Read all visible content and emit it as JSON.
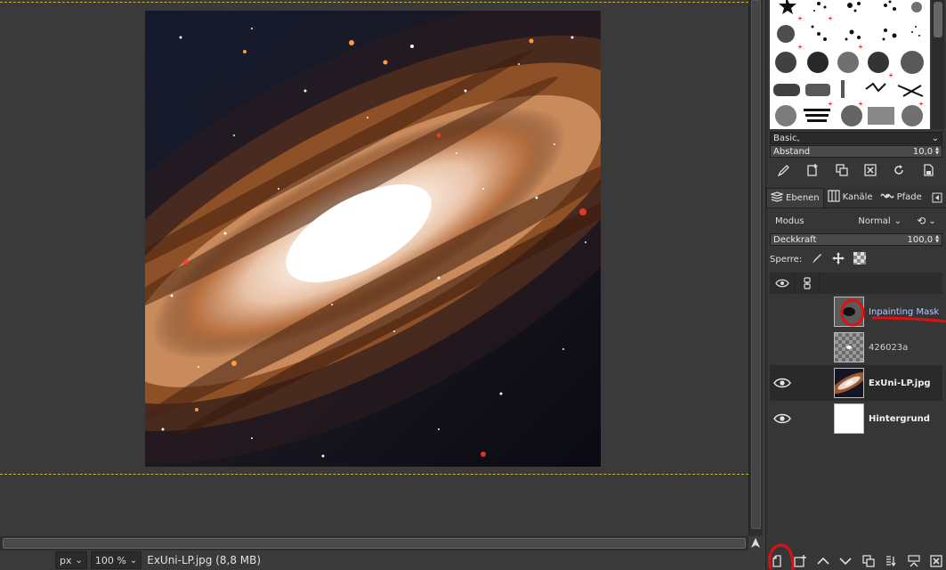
{
  "statusbar": {
    "unit": "px",
    "zoom": "100 %",
    "file": "ExUni-LP.jpg (8,8 MB)"
  },
  "brushes": {
    "preset": "Basic,",
    "spacing_label": "Abstand",
    "spacing_value": "10,0"
  },
  "tabs": [
    {
      "label": "Ebenen",
      "icon": "layers-icon"
    },
    {
      "label": "Kanäle",
      "icon": "channels-icon"
    },
    {
      "label": "Pfade",
      "icon": "paths-icon"
    }
  ],
  "layers_panel": {
    "mode_label": "Modus",
    "mode_value": "Normal",
    "opacity_label": "Deckkraft",
    "opacity_value": "100,0",
    "lock_label": "Sperre:"
  },
  "layers": [
    {
      "name": "Inpainting Mask",
      "visible": false,
      "thumbnail": "mask"
    },
    {
      "name": "426023a",
      "visible": false,
      "thumbnail": "transparent"
    },
    {
      "name": "ExUni-LP.jpg",
      "visible": true,
      "thumbnail": "galaxy",
      "selected": true
    },
    {
      "name": "Hintergrund",
      "visible": true,
      "thumbnail": "white"
    }
  ],
  "colors": {
    "annotation": "#e01010",
    "guide": "#c9b340"
  }
}
